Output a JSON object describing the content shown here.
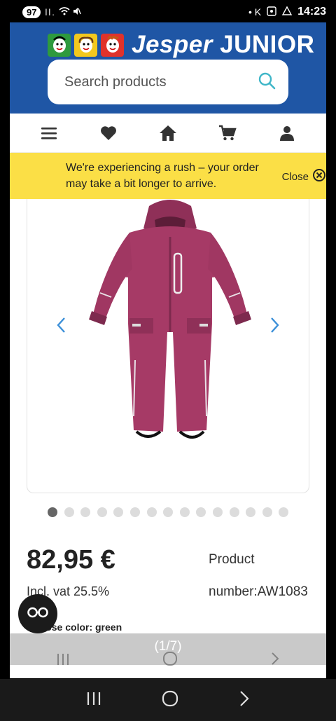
{
  "status": {
    "badge": "97",
    "left_icons": "ll.",
    "right_icons": "• K",
    "time": "14:23"
  },
  "header": {
    "brand_italic": "Jesper",
    "brand_bold": "JUNIOR",
    "search_placeholder": "Search products"
  },
  "nav": {
    "items": [
      "menu-icon",
      "heart-icon",
      "home-icon",
      "cart-icon",
      "user-icon"
    ]
  },
  "banner": {
    "text": "We're experiencing a rush – your order may take a bit longer to arrive.",
    "close_label": "Close"
  },
  "product": {
    "image_count_dots": 15,
    "active_dot": 0,
    "price": "82,95 €",
    "vat": "Incl. vat 25.5%",
    "product_label": "Product",
    "product_number": "number:AW1083",
    "choose_color": "Choose color: green",
    "counter": "(1/7)",
    "colors": {
      "suit": "#a63a66",
      "suit_dark": "#7d2a4e"
    }
  },
  "accent": {
    "header_blue": "#1f56a5",
    "banner_yellow": "#fbdf46",
    "link_blue": "#3b8fd8"
  }
}
